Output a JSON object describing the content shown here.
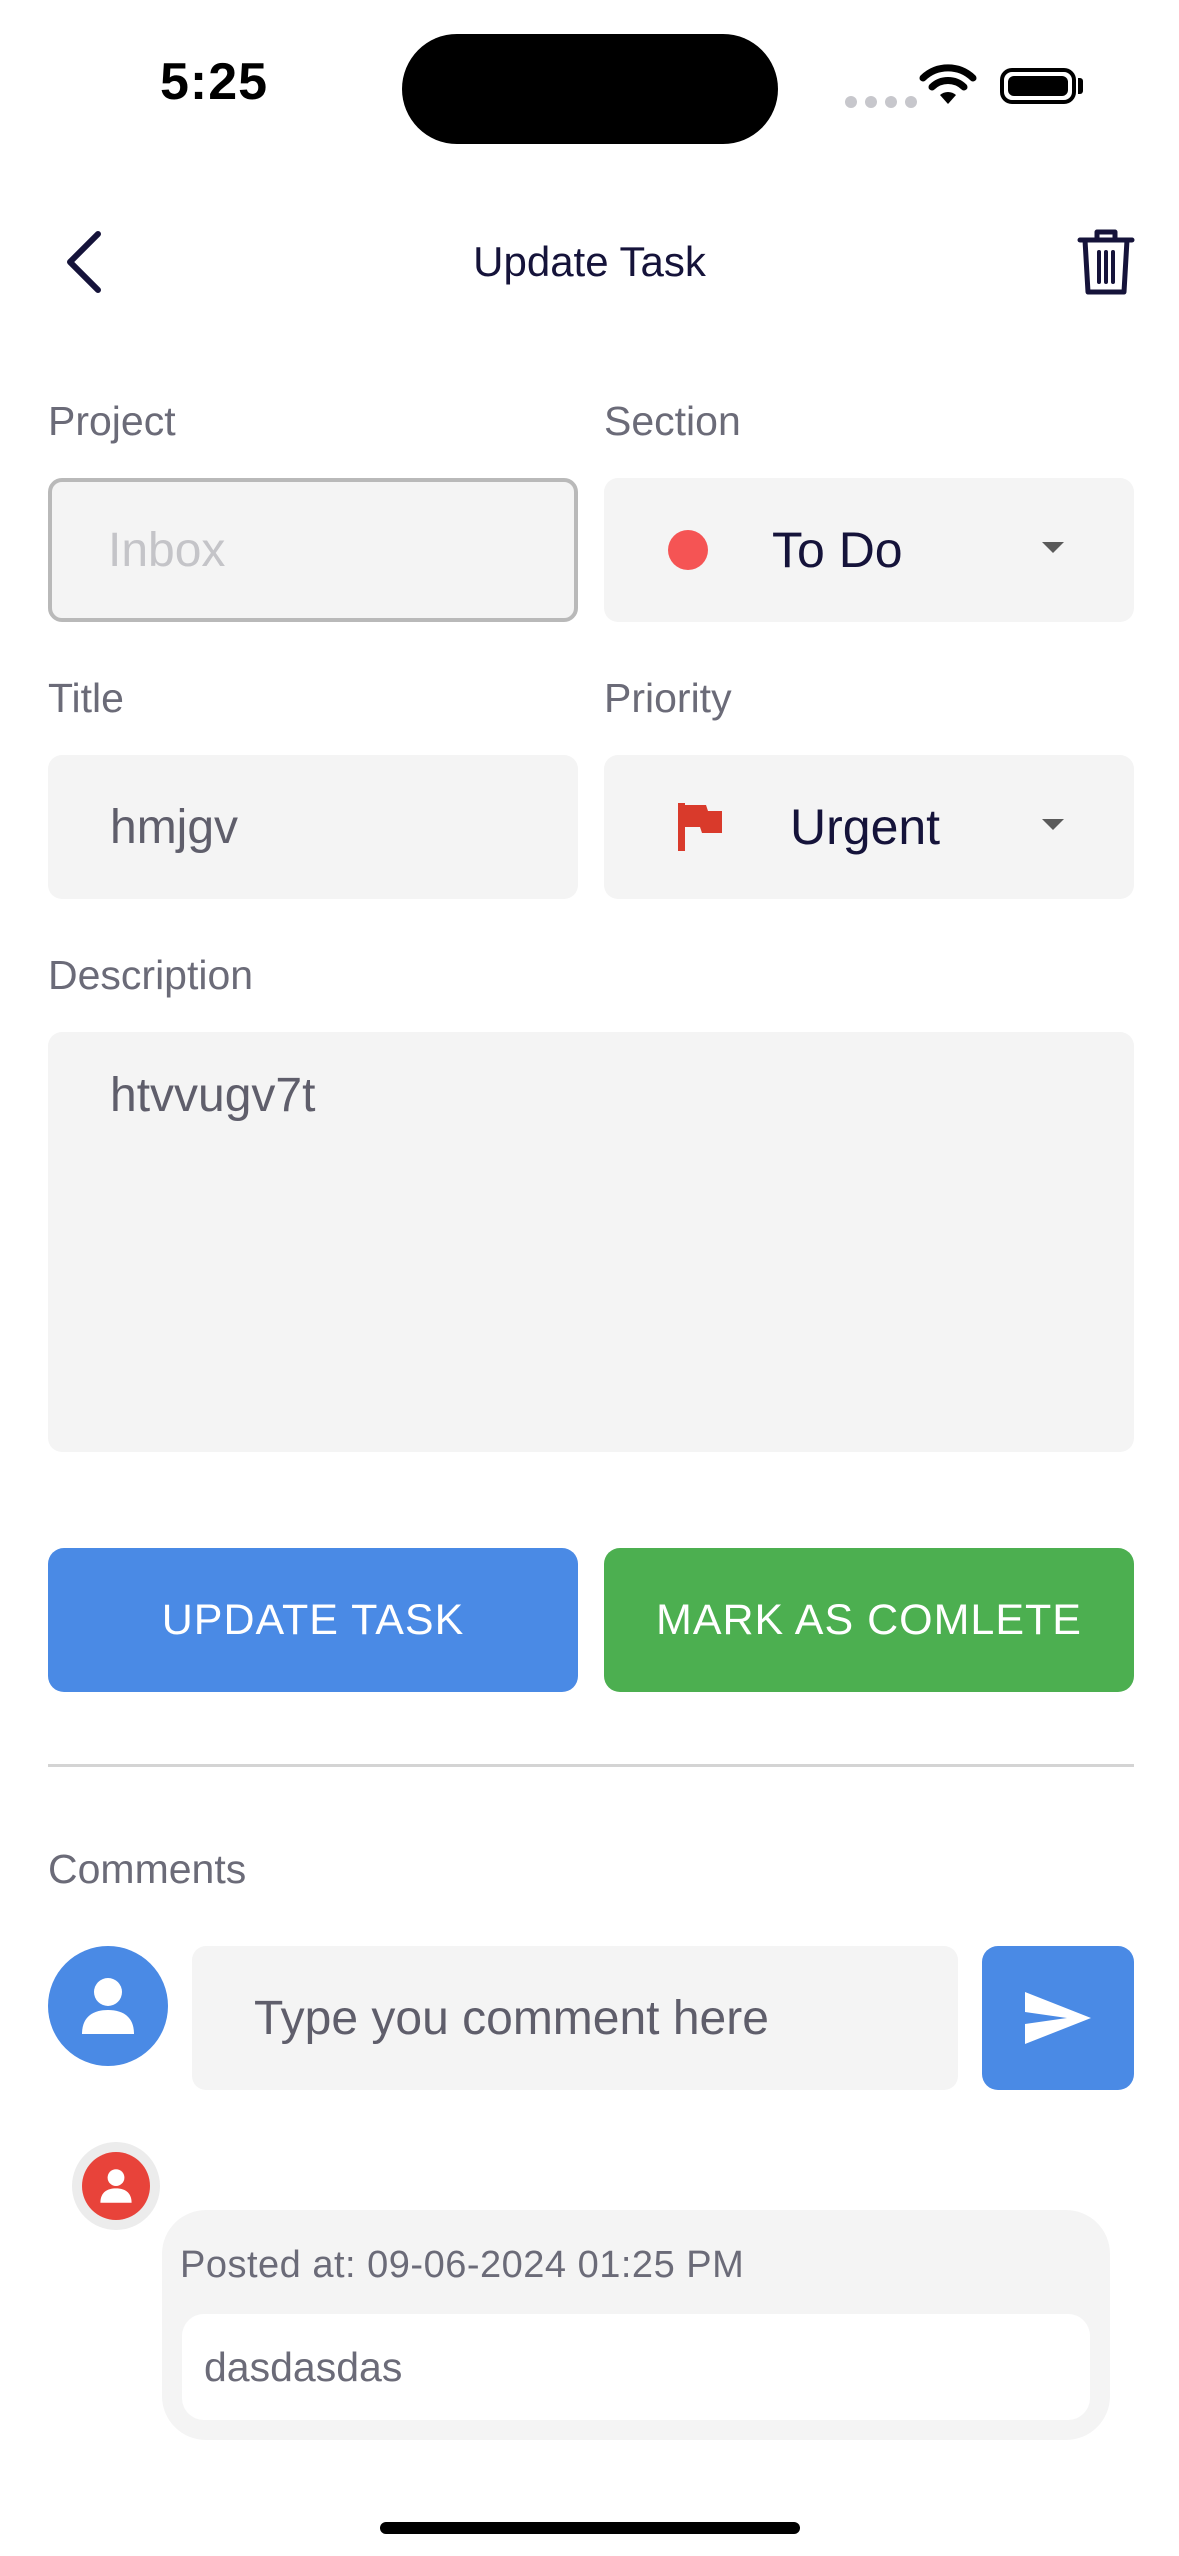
{
  "status_bar": {
    "time": "5:25"
  },
  "header": {
    "title": "Update Task"
  },
  "form": {
    "project": {
      "label": "Project",
      "placeholder": "Inbox"
    },
    "section": {
      "label": "Section",
      "value": "To Do",
      "dot_color": "#f55454"
    },
    "title": {
      "label": "Title",
      "value": "hmjgv"
    },
    "priority": {
      "label": "Priority",
      "value": "Urgent",
      "flag_color": "#d93a2b"
    },
    "description": {
      "label": "Description",
      "value": "htvvugv7t"
    }
  },
  "buttons": {
    "update": "UPDATE TASK",
    "complete": "MARK AS COMLETE"
  },
  "comments": {
    "label": "Comments",
    "input_placeholder": "Type you comment here",
    "items": [
      {
        "posted_at": "Posted at: 09-06-2024 01:25 PM",
        "text": "dasdasdas"
      }
    ]
  },
  "colors": {
    "primary": "#4a8ae5",
    "success": "#4caf50",
    "field_bg": "#f4f4f4"
  }
}
